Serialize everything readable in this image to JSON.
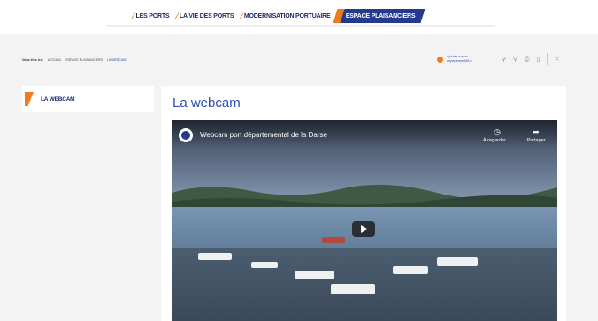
{
  "nav": {
    "items": [
      {
        "label": "LES PORTS",
        "active": false
      },
      {
        "label": "LA VIE DES PORTS",
        "active": false
      },
      {
        "label": "MODERNISATION PORTUAIRE",
        "active": false
      },
      {
        "label": "ESPACE PLAISANCIERS",
        "active": true
      }
    ],
    "accent_color": "#f07a1e",
    "active_bg": "#243a8f"
  },
  "breadcrumb": {
    "lead": "Vous êtes ici :",
    "items": [
      "ACCUEIL",
      "ESPACE PLAISANCIERS",
      "LA WEBCAM"
    ]
  },
  "tools": {
    "add_text": "Ajouter à mon département83.fr",
    "icons": [
      "link-icon",
      "link-icon",
      "print-icon",
      "file-icon",
      "share-icon"
    ]
  },
  "sidebar": {
    "label": "LA WEBCAM"
  },
  "main": {
    "title": "La webcam",
    "video": {
      "title": "Webcam port départemental de la Darse",
      "watch_later": "À regarder ...",
      "share": "Partager",
      "icons": [
        "clock-icon",
        "share-arrow-icon",
        "play-icon"
      ]
    }
  }
}
